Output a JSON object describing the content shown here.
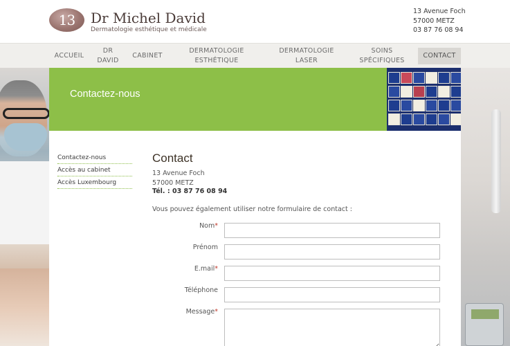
{
  "header": {
    "logo_number": "13",
    "name": "Dr Michel David",
    "subtitle": "Dermatologie esthétique et médicale",
    "address_line1": "13 Avenue Foch",
    "address_line2": "57000 METZ",
    "phone": "03 87 76 08 94"
  },
  "nav": {
    "items": [
      {
        "label": "ACCUEIL"
      },
      {
        "label": "DR DAVID"
      },
      {
        "label": "CABINET"
      },
      {
        "label": "DERMATOLOGIE ESTHÉTIQUE"
      },
      {
        "label": "DERMATOLOGIE LASER"
      },
      {
        "label": "SOINS SPÉCIFIQUES"
      },
      {
        "label": "CONTACT"
      }
    ],
    "active": "CONTACT"
  },
  "banner": {
    "title": "Contactez-nous"
  },
  "sidebar": {
    "links": [
      {
        "label": "Contactez-nous"
      },
      {
        "label": "Accès au cabinet"
      },
      {
        "label": "Accès Luxembourg"
      }
    ]
  },
  "main": {
    "title": "Contact",
    "address_line1": "13 Avenue Foch",
    "address_line2": "57000 METZ",
    "tel_label": "Tél. :",
    "tel_value": "03 87 76 08 94",
    "intro": "Vous pouvez également utiliser notre formulaire de contact :"
  },
  "form": {
    "nom_label": "Nom",
    "prenom_label": "Prénom",
    "email_label": "E.mail",
    "telephone_label": "Téléphone",
    "message_label": "Message",
    "required_marker": "*",
    "nom_value": "",
    "prenom_value": "",
    "email_value": "",
    "telephone_value": "",
    "message_value": ""
  },
  "colors": {
    "accent_green": "#8dbf48",
    "required_red": "#c0392b",
    "nav_bg": "#f0efec",
    "tile_blue": "#1c2f6e"
  }
}
